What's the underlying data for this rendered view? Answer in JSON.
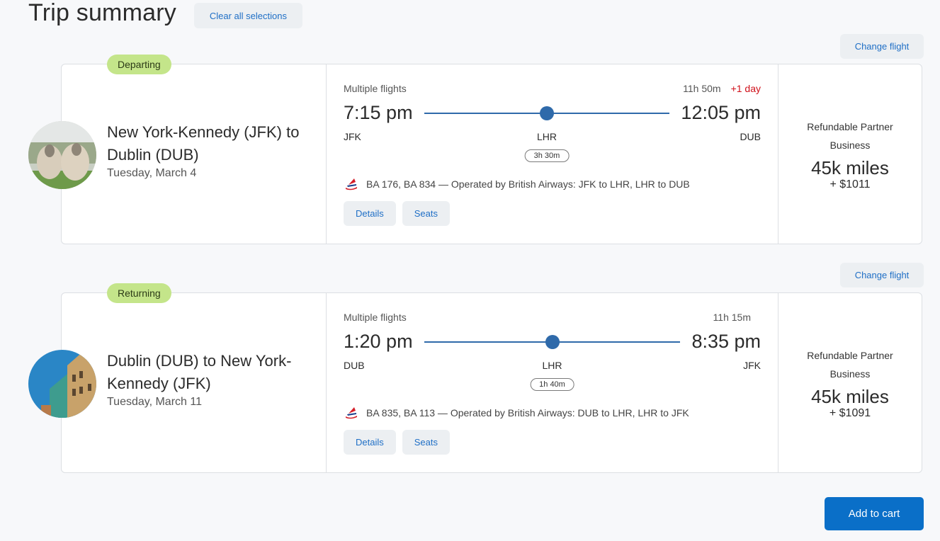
{
  "header": {
    "title": "Trip summary",
    "clear_label": "Clear all selections"
  },
  "segments": [
    {
      "badge": "Departing",
      "change_label": "Change flight",
      "route": "New York-Kennedy (JFK) to Dublin (DUB)",
      "date": "Tuesday, March 4",
      "image": "sheep-photo",
      "type_label": "Multiple flights",
      "duration": "11h 50m",
      "day_offset": "+1 day",
      "depart_time": "7:15 pm",
      "arrive_time": "12:05 pm",
      "origin": "JFK",
      "stop": "LHR",
      "destination": "DUB",
      "layover": "3h 30m",
      "stop_position": 0.5,
      "airline_icon": "british-airways-logo",
      "operated": "BA 176, BA 834 — Operated by British Airways: JFK to LHR, LHR to DUB",
      "details_label": "Details",
      "seats_label": "Seats",
      "fare_name": "Refundable Partner Business",
      "miles": "45k miles",
      "cash": "+ $1011"
    },
    {
      "badge": "Returning",
      "change_label": "Change flight",
      "route": "Dublin (DUB) to New York-Kennedy (JFK)",
      "date": "Tuesday, March 11",
      "image": "dublin-buildings-photo",
      "type_label": "Multiple flights",
      "duration": "11h 15m",
      "day_offset": "",
      "depart_time": "1:20 pm",
      "arrive_time": "8:35 pm",
      "origin": "DUB",
      "stop": "LHR",
      "destination": "JFK",
      "layover": "1h 40m",
      "stop_position": 0.5,
      "airline_icon": "british-airways-logo",
      "operated": "BA 835, BA 113 — Operated by British Airways: DUB to LHR, LHR to JFK",
      "details_label": "Details",
      "seats_label": "Seats",
      "fare_name": "Refundable Partner Business",
      "miles": "45k miles",
      "cash": "+ $1091"
    }
  ],
  "footer": {
    "add_to_cart_label": "Add to cart"
  },
  "colors": {
    "accent": "#0a6fc8",
    "link": "#1f6fc6",
    "badge": "#c4e58a",
    "route_line": "#2f6aaa",
    "day_offset": "#d0101a"
  }
}
